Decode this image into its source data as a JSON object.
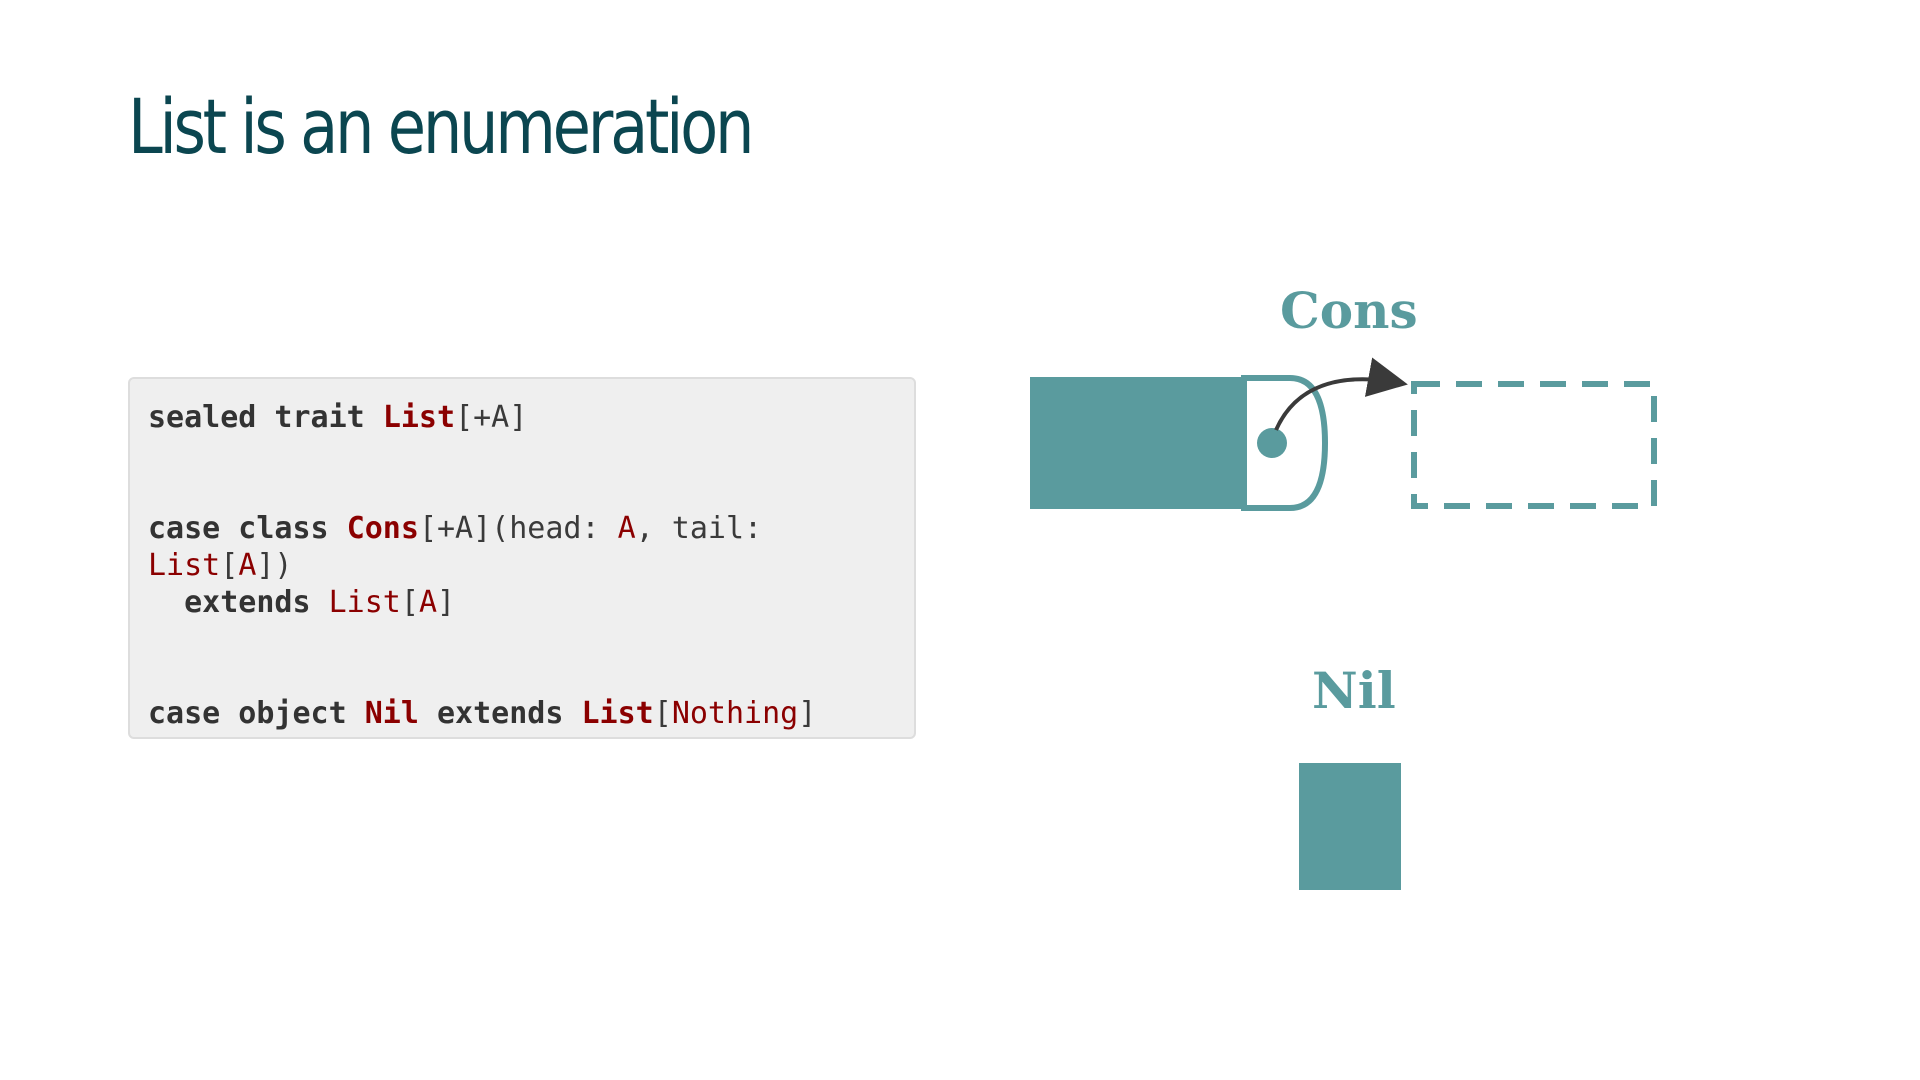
{
  "slide": {
    "title": "List is an enumeration"
  },
  "code": {
    "line1": {
      "kw": "sealed trait ",
      "type_bold": "List",
      "rest": "[+A]"
    },
    "line2": {
      "kw": "case class ",
      "type_bold": "Cons",
      "p1": "[+A](head: ",
      "t1": "A",
      "p2": ", tail:"
    },
    "line3": {
      "t1": "List",
      "p1": "[",
      "t2": "A",
      "p2": "])"
    },
    "line4": {
      "kw": "extends ",
      "t1": "List",
      "p1": "[",
      "t2": "A",
      "p2": "]"
    },
    "line5": {
      "kw1": "case object ",
      "type_bold": "Nil",
      "kw2": " extends ",
      "type_bold2": "List",
      "p1": "[",
      "t1": "Nothing",
      "p2": "]"
    }
  },
  "diagram": {
    "cons_label": "Cons",
    "nil_label": "Nil",
    "accent_color": "#5a9b9e",
    "arrow_color": "#3a3a3a"
  }
}
